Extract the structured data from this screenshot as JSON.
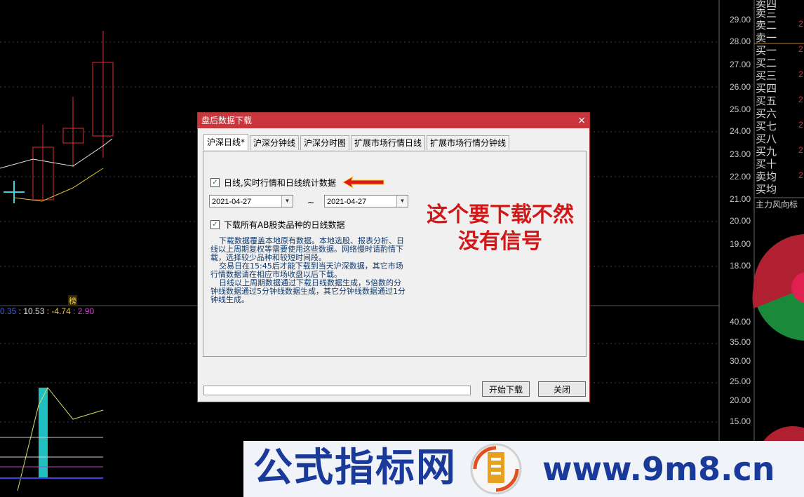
{
  "dialog": {
    "title": "盘后数据下载",
    "close_glyph": "×",
    "tabs": [
      {
        "label": "沪深日线*",
        "active": true
      },
      {
        "label": "沪深分钟线",
        "active": false
      },
      {
        "label": "沪深分时图",
        "active": false
      },
      {
        "label": "扩展市场行情日线",
        "active": false
      },
      {
        "label": "扩展市场行情分钟线",
        "active": false
      }
    ],
    "checkbox_daily": {
      "label": "日线,实时行情和日线统计数据",
      "checked": true
    },
    "date_from": "2021-04-27",
    "date_sep": "~",
    "date_to": "2021-04-27",
    "checkbox_ab": {
      "label": "下载所有AB股类品种的日线数据",
      "checked": true
    },
    "info": [
      "下载数据覆盖本地原有数据。本地选股、报表分析、日线以上周期复权等需要使用这些数据。网络慢时请酌情下载，选择较少品种和较短时间段。",
      "交易日在15:45后才能下载到当天沪深数据，其它市场行情数据请在相应市场收盘以后下载。",
      "日线以上周期数据通过下载日线数据生成，5倍数的分钟线数据通过5分钟线数据生成，其它分钟线数据通过1分钟线生成。"
    ],
    "start_button": "开始下载",
    "close_button": "关闭"
  },
  "annotation": {
    "line1": "这个要下载不然",
    "line2": "没有信号"
  },
  "chart_side": {
    "price_ticks": [
      "29.00",
      "28.00",
      "27.00",
      "26.00",
      "25.00",
      "24.00",
      "23.00",
      "22.00",
      "21.00",
      "20.00",
      "19.00",
      "18.00"
    ],
    "vol_ticks": [
      "40.00",
      "35.00",
      "30.00",
      "25.00",
      "20.00",
      "15.00"
    ],
    "order_book": [
      "卖四",
      "卖三",
      "卖二",
      "卖一",
      "买一",
      "买二",
      "买三",
      "买四",
      "买五",
      "买六",
      "买七",
      "买八",
      "买九",
      "买十",
      "卖均",
      "买均"
    ],
    "order_val": "2",
    "indicator_name": "主力风向标",
    "readout": [
      {
        "text": "0.35",
        "color": "#3a5aff"
      },
      {
        "text": ": 10.53",
        "color": "#e0e0e0"
      },
      {
        "text": ": -4.74",
        "color": "#f0c040"
      },
      {
        "text": ": 2.90",
        "color": "#d040d0"
      }
    ],
    "tag": "榜"
  },
  "banner": {
    "left_text": "公式指标网",
    "right_text": "www.9m8.cn",
    "logo_text": "www.9m8.cn"
  },
  "colors": {
    "accent": "#c9353a",
    "annotation": "#d01818",
    "banner_text": "#1a3a9a"
  }
}
